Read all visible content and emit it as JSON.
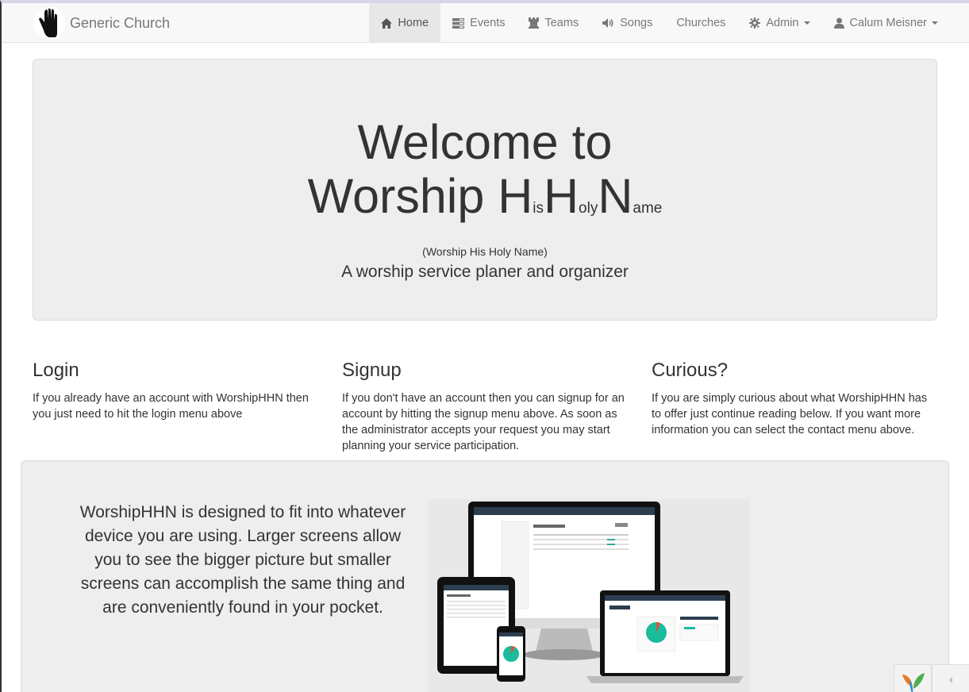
{
  "navbar": {
    "brand": "Generic Church",
    "items": [
      {
        "label": "Home",
        "icon": "home-icon"
      },
      {
        "label": "Events",
        "icon": "tasks-icon"
      },
      {
        "label": "Teams",
        "icon": "tower-icon"
      },
      {
        "label": "Songs",
        "icon": "volume-icon"
      },
      {
        "label": "Churches",
        "icon": ""
      },
      {
        "label": "Admin",
        "icon": "cog-icon"
      },
      {
        "label": "Calum Meisner",
        "icon": "user-icon"
      }
    ]
  },
  "jumbotron": {
    "line1": "Welcome to",
    "worship": "Worship ",
    "h1": "H",
    "is": "is",
    "h2": "H",
    "oly": "oly",
    "n": "N",
    "ame": "ame",
    "subtitle": "(Worship His Holy Name)",
    "tagline": "A worship service planer and organizer"
  },
  "columns": [
    {
      "title": "Login",
      "text": "If you already have an account with WorshipHHN then you just need to hit the login menu above"
    },
    {
      "title": "Signup",
      "text": "If you don't have an account then you can signup for an account by hitting the signup menu above. As soon as the administrator accepts your request you may start planning your service participation."
    },
    {
      "title": "Curious?",
      "text": "If you are simply curious about what WorshipHHN has to offer just continue reading below. If you want more information you can select the contact menu above."
    }
  ],
  "feature": {
    "text": "WorshipHHN is designed to fit into whatever device you are using. Larger screens allow you to see the bigger picture but smaller screens can accomplish the same thing and are conveniently found in your pocket."
  },
  "colors": {
    "navbar_bg": "#f8f8f8",
    "jumbotron_bg": "#eeeeee",
    "pie_accent": "#1abc9c"
  }
}
